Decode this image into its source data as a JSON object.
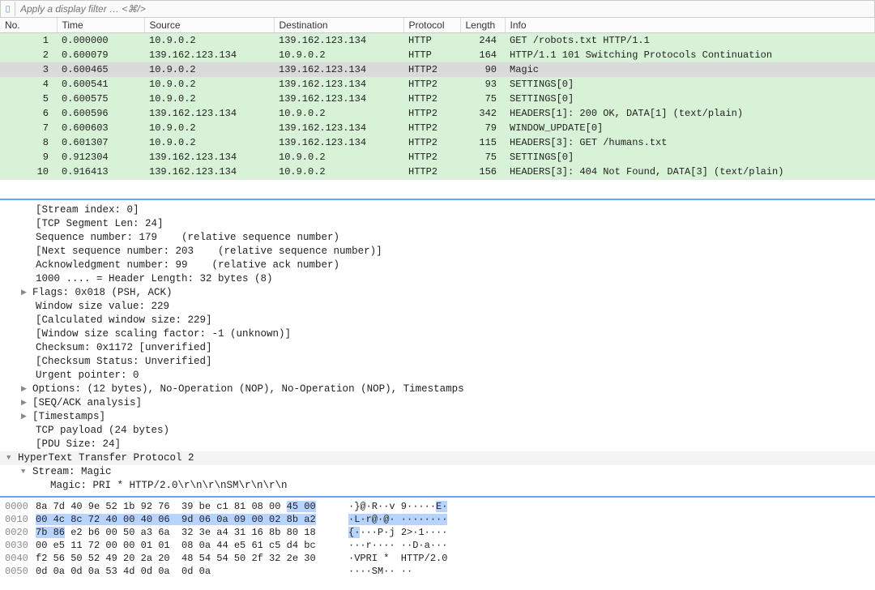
{
  "filter": {
    "placeholder": "Apply a display filter … <⌘/>"
  },
  "columns": {
    "no": "No.",
    "time": "Time",
    "src": "Source",
    "dst": "Destination",
    "proto": "Protocol",
    "len": "Length",
    "info": "Info"
  },
  "packets": [
    {
      "no": "1",
      "time": "0.000000",
      "src": "10.9.0.2",
      "dst": "139.162.123.134",
      "proto": "HTTP",
      "len": "244",
      "info": "GET /robots.txt HTTP/1.1",
      "sel": false
    },
    {
      "no": "2",
      "time": "0.600079",
      "src": "139.162.123.134",
      "dst": "10.9.0.2",
      "proto": "HTTP",
      "len": "164",
      "info": "HTTP/1.1 101 Switching Protocols Continuation",
      "sel": false
    },
    {
      "no": "3",
      "time": "0.600465",
      "src": "10.9.0.2",
      "dst": "139.162.123.134",
      "proto": "HTTP2",
      "len": "90",
      "info": "Magic",
      "sel": true
    },
    {
      "no": "4",
      "time": "0.600541",
      "src": "10.9.0.2",
      "dst": "139.162.123.134",
      "proto": "HTTP2",
      "len": "93",
      "info": "SETTINGS[0]",
      "sel": false
    },
    {
      "no": "5",
      "time": "0.600575",
      "src": "10.9.0.2",
      "dst": "139.162.123.134",
      "proto": "HTTP2",
      "len": "75",
      "info": "SETTINGS[0]",
      "sel": false
    },
    {
      "no": "6",
      "time": "0.600596",
      "src": "139.162.123.134",
      "dst": "10.9.0.2",
      "proto": "HTTP2",
      "len": "342",
      "info": "HEADERS[1]: 200 OK, DATA[1] (text/plain)",
      "sel": false
    },
    {
      "no": "7",
      "time": "0.600603",
      "src": "10.9.0.2",
      "dst": "139.162.123.134",
      "proto": "HTTP2",
      "len": "79",
      "info": "WINDOW_UPDATE[0]",
      "sel": false
    },
    {
      "no": "8",
      "time": "0.601307",
      "src": "10.9.0.2",
      "dst": "139.162.123.134",
      "proto": "HTTP2",
      "len": "115",
      "info": "HEADERS[3]: GET /humans.txt",
      "sel": false
    },
    {
      "no": "9",
      "time": "0.912304",
      "src": "139.162.123.134",
      "dst": "10.9.0.2",
      "proto": "HTTP2",
      "len": "75",
      "info": "SETTINGS[0]",
      "sel": false
    },
    {
      "no": "10",
      "time": "0.916413",
      "src": "139.162.123.134",
      "dst": "10.9.0.2",
      "proto": "HTTP2",
      "len": "156",
      "info": "HEADERS[3]: 404 Not Found, DATA[3] (text/plain)",
      "sel": false
    }
  ],
  "details": [
    {
      "lvl": 1,
      "style": "",
      "text": "[Stream index: 0]"
    },
    {
      "lvl": 1,
      "style": "",
      "text": "[TCP Segment Len: 24]"
    },
    {
      "lvl": 1,
      "style": "",
      "text": "Sequence number: 179    (relative sequence number)"
    },
    {
      "lvl": 1,
      "style": "",
      "text": "[Next sequence number: 203    (relative sequence number)]"
    },
    {
      "lvl": 1,
      "style": "",
      "text": "Acknowledgment number: 99    (relative ack number)"
    },
    {
      "lvl": 1,
      "style": "",
      "text": "1000 .... = Header Length: 32 bytes (8)"
    },
    {
      "lvl": 1,
      "style": "collapsed",
      "text": "Flags: 0x018 (PSH, ACK)"
    },
    {
      "lvl": 1,
      "style": "",
      "text": "Window size value: 229"
    },
    {
      "lvl": 1,
      "style": "",
      "text": "[Calculated window size: 229]"
    },
    {
      "lvl": 1,
      "style": "",
      "text": "[Window size scaling factor: -1 (unknown)]"
    },
    {
      "lvl": 1,
      "style": "",
      "text": "Checksum: 0x1172 [unverified]"
    },
    {
      "lvl": 1,
      "style": "",
      "text": "[Checksum Status: Unverified]"
    },
    {
      "lvl": 1,
      "style": "",
      "text": "Urgent pointer: 0"
    },
    {
      "lvl": 1,
      "style": "collapsed",
      "text": "Options: (12 bytes), No-Operation (NOP), No-Operation (NOP), Timestamps"
    },
    {
      "lvl": 1,
      "style": "collapsed",
      "text": "[SEQ/ACK analysis]"
    },
    {
      "lvl": 1,
      "style": "collapsed",
      "text": "[Timestamps]"
    },
    {
      "lvl": 1,
      "style": "",
      "text": "TCP payload (24 bytes)"
    },
    {
      "lvl": 1,
      "style": "",
      "text": "[PDU Size: 24]"
    },
    {
      "lvl": 0,
      "style": "expanded section",
      "text": "HyperText Transfer Protocol 2"
    },
    {
      "lvl": 1,
      "style": "expanded",
      "text": "Stream: Magic"
    },
    {
      "lvl": 2,
      "style": "",
      "text": "Magic: PRI * HTTP/2.0\\r\\n\\r\\nSM\\r\\n\\r\\n"
    }
  ],
  "hex": [
    {
      "off": "0000",
      "b1": "8a 7d 40 9e 52 1b 92 76  39 be c1 81 08 00 ",
      "b1h": "45 00",
      "ascii": "·}@·R··v 9·····",
      "asciih": "E·"
    },
    {
      "off": "0010",
      "b1": "",
      "b1h": "00 4c 8c 72 40 00 40 06  9d 06 0a 09 00 02 8b a2",
      "ascii": "",
      "asciih": "·L·r@·@· ········"
    },
    {
      "off": "0020",
      "b1": "",
      "b1h": "7b 86",
      "b2": " e2 b6 00 50 a3 6a  32 3e a4 31 16 8b 80 18",
      "ascii": "",
      "asciih": "{·",
      "ascii2": "···P·j 2>·1····"
    },
    {
      "off": "0030",
      "b1": "00 e5 11 72 00 00 01 01  08 0a 44 e5 61 c5 d4 bc",
      "ascii": "···r···· ··D·a···"
    },
    {
      "off": "0040",
      "b1": "f2 56 50 52 49 20 2a 20  48 54 54 50 2f 32 2e 30",
      "ascii": "·VPRI *  HTTP/2.0"
    },
    {
      "off": "0050",
      "b1": "0d 0a 0d 0a 53 4d 0d 0a  0d 0a",
      "ascii": "····SM·· ··"
    }
  ]
}
